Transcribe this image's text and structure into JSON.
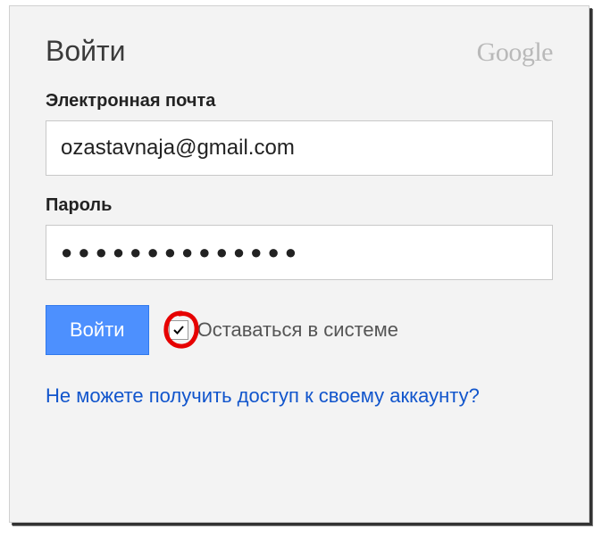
{
  "header": {
    "title": "Войти",
    "brand": "Google"
  },
  "form": {
    "email": {
      "label": "Электронная почта",
      "value": "ozastavnaja@gmail.com"
    },
    "password": {
      "label": "Пароль",
      "value": "●●●●●●●●●●●●●●"
    },
    "submit_label": "Войти",
    "stay_signed_in": {
      "label": "Оставаться в системе",
      "checked": true
    }
  },
  "links": {
    "recover": "Не можете получить доступ к своему аккаунту?"
  },
  "annotation": {
    "highlight_color": "#e60000"
  }
}
